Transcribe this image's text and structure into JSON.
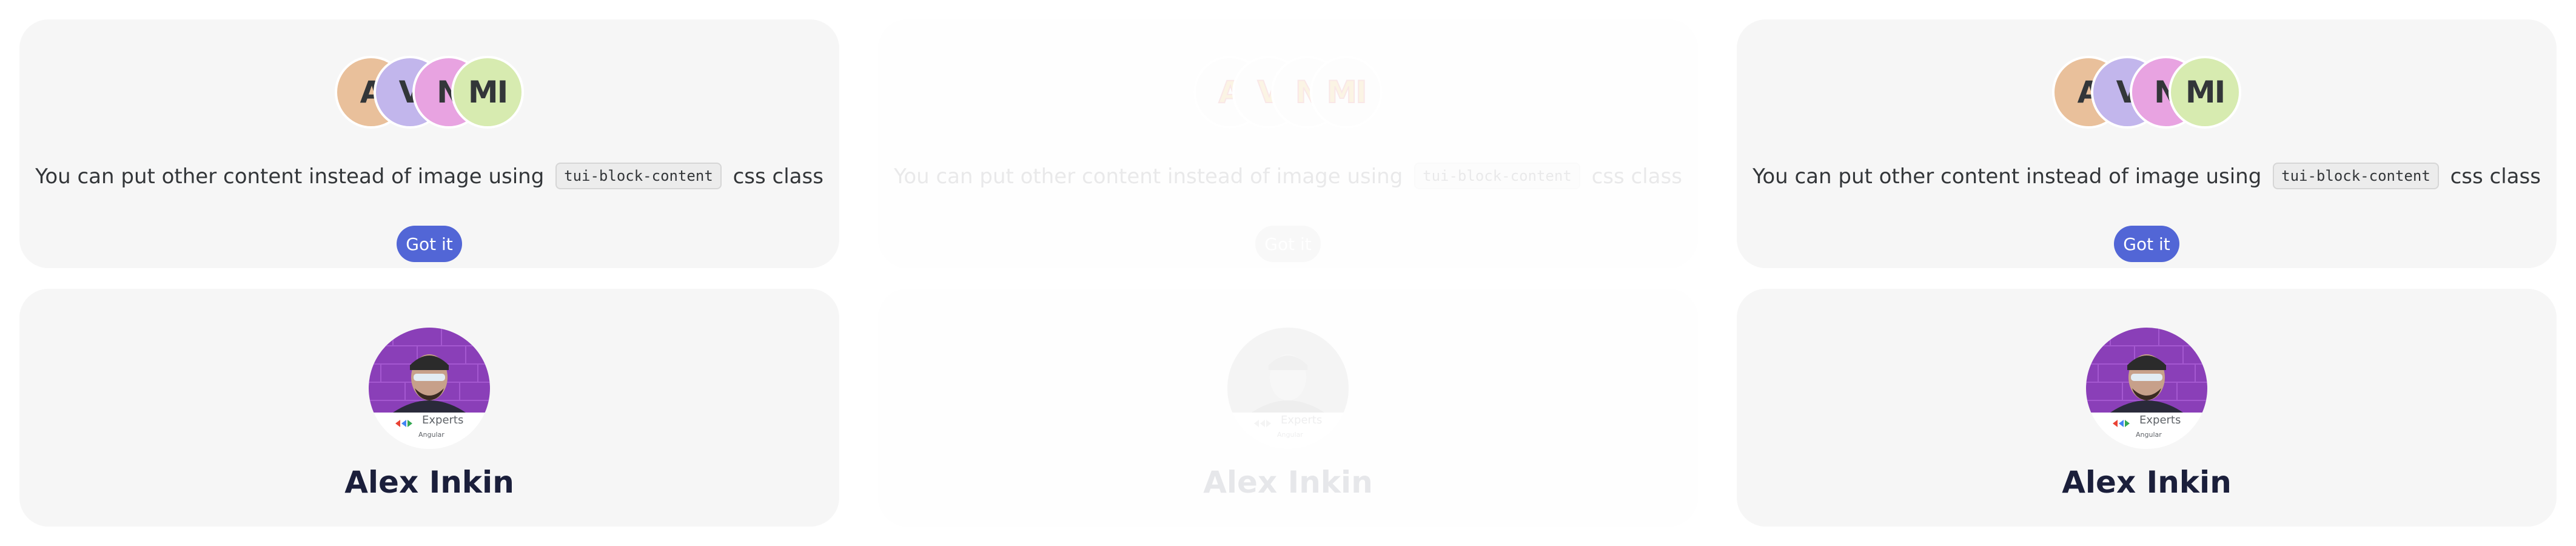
{
  "cards": [
    {
      "state": "default",
      "avatars": [
        "A",
        "V",
        "N",
        "MI"
      ],
      "description_before": "You can put other content instead of image using",
      "code": "tui-block-content",
      "description_after": "css class",
      "button_label": "Got it"
    },
    {
      "state": "disabled",
      "avatars": [
        "A",
        "V",
        "N",
        "MI"
      ],
      "description_before": "You can put other content instead of image using",
      "code": "tui-block-content",
      "description_after": "css class",
      "button_label": "Got it"
    },
    {
      "state": "default",
      "avatars": [
        "A",
        "V",
        "N",
        "MI"
      ],
      "description_before": "You can put other content instead of image using",
      "code": "tui-block-content",
      "description_after": "css class",
      "button_label": "Got it"
    }
  ],
  "profiles": [
    {
      "state": "default",
      "name": "Alex Inkin",
      "badge_title": "Experts",
      "badge_subtitle": "Angular"
    },
    {
      "state": "disabled",
      "name": "Alex Inkin",
      "badge_title": "Experts",
      "badge_subtitle": "Angular"
    },
    {
      "state": "default",
      "name": "Alex Inkin",
      "badge_title": "Experts",
      "badge_subtitle": "Angular"
    }
  ],
  "colors": {
    "card_bg": "#f6f6f6",
    "button_bg": "#5266d6",
    "name_text": "#1b1f3b",
    "avatar_a": "#e9c09b",
    "avatar_v": "#c2b6ec",
    "avatar_n": "#e8a3e1",
    "avatar_mi": "#d7ebb0"
  }
}
